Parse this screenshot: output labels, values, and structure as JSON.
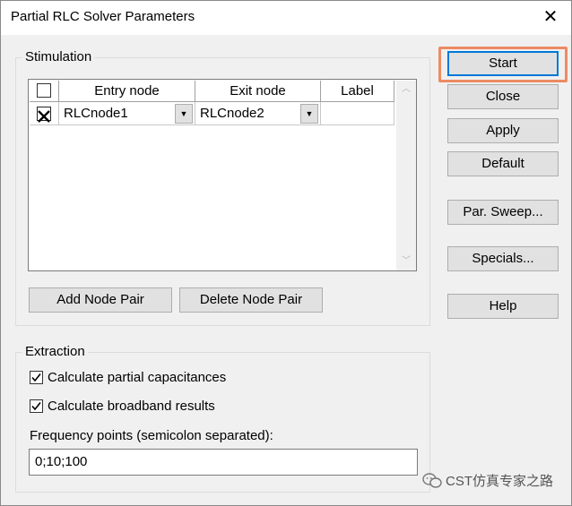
{
  "window": {
    "title": "Partial RLC Solver Parameters",
    "close_symbol": "✕"
  },
  "stimulation": {
    "group_label": "Stimulation",
    "columns": [
      "Entry node",
      "Exit node",
      "Label"
    ],
    "rows": [
      {
        "checked": true,
        "entry": "RLCnode1",
        "exit": "RLCnode2",
        "label": ""
      }
    ],
    "add_button": "Add Node Pair",
    "delete_button": "Delete Node Pair"
  },
  "extraction": {
    "group_label": "Extraction",
    "partial_capacitances": {
      "label": "Calculate partial capacitances",
      "checked": true
    },
    "broadband_results": {
      "label": "Calculate broadband results",
      "checked": true
    },
    "frequency_label": "Frequency points (semicolon separated):",
    "frequency_value": "0;10;100"
  },
  "side_buttons": {
    "start": "Start",
    "close": "Close",
    "apply": "Apply",
    "default": "Default",
    "par_sweep": "Par. Sweep...",
    "specials": "Specials...",
    "help": "Help"
  },
  "watermark": {
    "text": "CST仿真专家之路",
    "icon": "wechat-icon"
  },
  "colors": {
    "default_button_border": "#0078d7",
    "highlight_ring": "#ec8b63",
    "dialog_bg": "#f0f0f0"
  }
}
